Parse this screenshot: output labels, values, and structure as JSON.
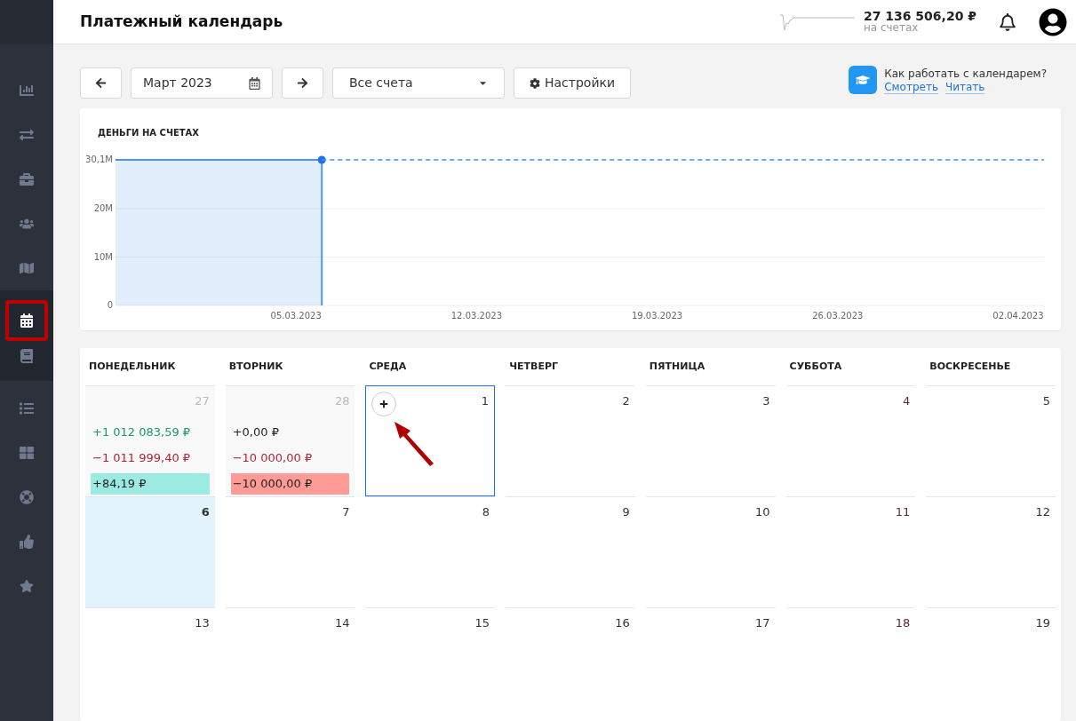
{
  "header": {
    "title": "Платежный календарь",
    "balance": "27 136 506,20 ₽",
    "balance_caption": "на счетах"
  },
  "sidebar": {
    "groups": [
      {
        "items": [
          {
            "selected": false,
            "highlighted": false
          },
          {
            "selected": false,
            "highlighted": false
          },
          {
            "selected": false,
            "highlighted": false
          },
          {
            "selected": false,
            "highlighted": false
          },
          {
            "selected": false,
            "highlighted": false
          }
        ]
      },
      {
        "items": [
          {
            "selected": true,
            "highlighted": true
          },
          {
            "selected": false,
            "highlighted": false
          }
        ]
      },
      {
        "items": [
          {
            "selected": false,
            "highlighted": false
          },
          {
            "selected": false,
            "highlighted": false
          },
          {
            "selected": false,
            "highlighted": false
          },
          {
            "selected": false,
            "highlighted": false
          },
          {
            "selected": false,
            "highlighted": false
          }
        ]
      }
    ]
  },
  "toolbar": {
    "month": "Март 2023",
    "accounts": "Все счета",
    "settings": "Настройки"
  },
  "help": {
    "question": "Как работать с календарем?",
    "links": [
      "Смотреть",
      "Читать"
    ]
  },
  "chart": {
    "title": "ДЕНЬГИ НА СЧЕТАХ",
    "chart_data": {
      "type": "area",
      "categories": [
        null,
        null,
        null,
        null,
        null,
        null,
        null,
        "05.03.2023",
        null,
        null,
        null,
        null,
        null,
        null,
        "12.03.2023",
        null,
        null,
        null,
        null,
        null,
        null,
        "19.03.2023",
        null,
        null,
        null,
        null,
        null,
        null,
        "26.03.2023",
        null,
        null,
        null,
        null,
        null,
        null,
        "02.04.2023",
        null
      ],
      "series": [
        {
          "type": "area",
          "line_style": "solid",
          "color": "#1a73e8",
          "values": [
            30.1,
            30.1,
            30.1,
            30.1,
            30.1,
            30.1,
            30.1,
            30.1,
            30.1,
            null,
            null,
            null,
            null,
            null,
            null,
            null,
            null,
            null,
            null,
            null,
            null,
            null,
            null,
            null,
            null,
            null,
            null,
            null,
            null,
            null,
            null,
            null,
            null,
            null,
            null,
            null,
            null
          ]
        },
        {
          "type": "line",
          "line_style": "dashed",
          "color": "#4a90e2",
          "values": [
            null,
            null,
            null,
            null,
            null,
            null,
            null,
            null,
            30.1,
            30.1,
            30.1,
            30.1,
            30.1,
            30.1,
            30.1,
            30.1,
            30.1,
            30.1,
            30.1,
            30.1,
            30.1,
            30.1,
            30.1,
            30.1,
            30.1,
            30.1,
            30.1,
            30.1,
            30.1,
            30.1,
            30.1,
            30.1,
            30.1,
            30.1,
            30.1,
            30.1,
            30.1
          ]
        }
      ],
      "ylim": [
        0,
        30.1
      ],
      "yticks": [
        0,
        {
          "value": 10,
          "label": "10M"
        },
        {
          "value": 20,
          "label": "20M"
        },
        {
          "value": 30.1,
          "label": "30,1M"
        }
      ]
    }
  },
  "calendar": {
    "weekdays": [
      "ПОНЕДЕЛЬНИК",
      "ВТОРНИК",
      "СРЕДА",
      "ЧЕТВЕРГ",
      "ПЯТНИЦА",
      "СУББОТА",
      "ВОСКРЕСЕНЬЕ"
    ],
    "weeks": [
      [
        {
          "day": "27",
          "other_month": true,
          "today": false,
          "selected": false,
          "entries": [
            {
              "kind": "income",
              "text": "+1 012 083,59 ₽"
            },
            {
              "kind": "expense",
              "text": "−1 011 999,40 ₽"
            },
            {
              "kind": "total_positive",
              "text": "+84,19 ₽"
            }
          ]
        },
        {
          "day": "28",
          "other_month": true,
          "today": false,
          "selected": false,
          "entries": [
            {
              "kind": "neutral",
              "text": "+0,00 ₽"
            },
            {
              "kind": "expense",
              "text": "−10 000,00 ₽"
            },
            {
              "kind": "total_negative",
              "text": "−10 000,00 ₽"
            }
          ]
        },
        {
          "day": "1",
          "other_month": false,
          "today": false,
          "selected": true
        },
        {
          "day": "2",
          "other_month": false,
          "today": false,
          "selected": false
        },
        {
          "day": "3",
          "other_month": false,
          "today": false,
          "selected": false
        },
        {
          "day": "4",
          "other_month": false,
          "today": false,
          "selected": false
        },
        {
          "day": "5",
          "other_month": false,
          "today": false,
          "selected": false
        }
      ],
      [
        {
          "day": "6",
          "other_month": false,
          "today": true,
          "selected": false
        },
        {
          "day": "7",
          "other_month": false,
          "today": false,
          "selected": false
        },
        {
          "day": "8",
          "other_month": false,
          "today": false,
          "selected": false
        },
        {
          "day": "9",
          "other_month": false,
          "today": false,
          "selected": false
        },
        {
          "day": "10",
          "other_month": false,
          "today": false,
          "selected": false
        },
        {
          "day": "11",
          "other_month": false,
          "today": false,
          "selected": false
        },
        {
          "day": "12",
          "other_month": false,
          "today": false,
          "selected": false
        }
      ],
      [
        {
          "day": "13",
          "other_month": false,
          "today": false,
          "selected": false
        },
        {
          "day": "14",
          "other_month": false,
          "today": false,
          "selected": false
        },
        {
          "day": "15",
          "other_month": false,
          "today": false,
          "selected": false
        },
        {
          "day": "16",
          "other_month": false,
          "today": false,
          "selected": false
        },
        {
          "day": "17",
          "other_month": false,
          "today": false,
          "selected": false
        },
        {
          "day": "18",
          "other_month": false,
          "today": false,
          "selected": false
        },
        {
          "day": "19",
          "other_month": false,
          "today": false,
          "selected": false
        }
      ]
    ]
  }
}
